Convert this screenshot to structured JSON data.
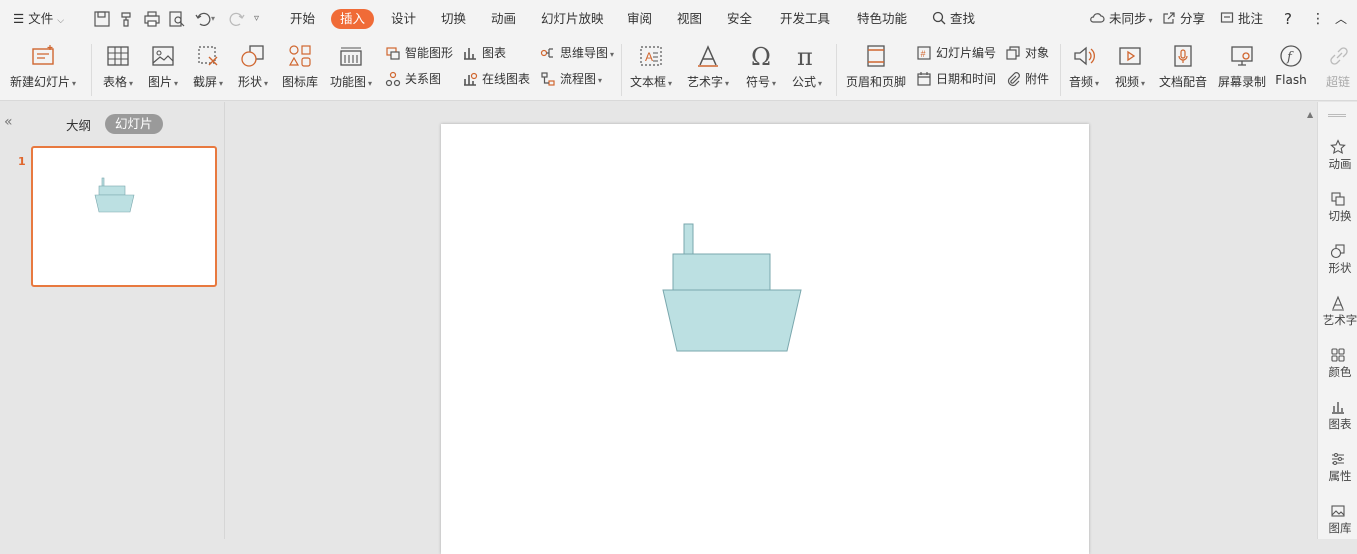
{
  "menubar": {
    "file_label": "文件",
    "tabs": [
      "开始",
      "插入",
      "设计",
      "切换",
      "动画",
      "幻灯片放映",
      "审阅",
      "视图",
      "安全",
      "开发工具",
      "特色功能"
    ],
    "active_tab": "插入",
    "search_label": "查找",
    "sync_label": "未同步",
    "share_label": "分享",
    "comment_label": "批注",
    "help_label": "?"
  },
  "ribbon": {
    "new_slide": "新建幻灯片",
    "table": "表格",
    "picture": "图片",
    "screenshot": "截屏",
    "shape": "形状",
    "icon_library": "图标库",
    "function_chart": "功能图",
    "smart_art": "智能图形",
    "chart": "图表",
    "relation": "关系图",
    "online_chart": "在线图表",
    "mind_map": "思维导图",
    "flowchart": "流程图",
    "textbox": "文本框",
    "art_text": "艺术字",
    "symbol": "符号",
    "formula": "公式",
    "header_footer": "页眉和页脚",
    "slide_number": "幻灯片编号",
    "object": "对象",
    "date_time": "日期和时间",
    "attachment": "附件",
    "audio": "音频",
    "video": "视频",
    "doc_dubbing": "文档配音",
    "screen_record": "屏幕录制",
    "flash": "Flash",
    "hyperlink": "超链"
  },
  "leftpanel": {
    "outline_tab": "大纲",
    "slides_tab": "幻灯片",
    "slide_number": "1"
  },
  "rail": [
    "动画",
    "切换",
    "形状",
    "艺术字",
    "颜色",
    "图表",
    "属性",
    "图库"
  ],
  "colors": {
    "accent": "#f06b37",
    "boat_fill": "#bce0e2",
    "boat_stroke": "#7aa7ad"
  }
}
